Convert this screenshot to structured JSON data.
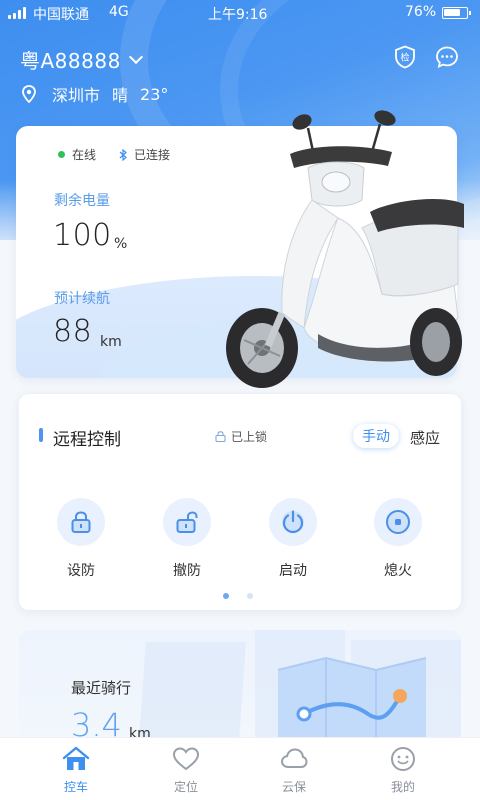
{
  "status_bar": {
    "carrier": "中国联通",
    "network": "4G",
    "time": "上午9:16",
    "battery": "76%"
  },
  "header": {
    "plate": "粤A88888",
    "city": "深圳市",
    "weather": "晴",
    "temperature": "23°",
    "inspect_badge": "检"
  },
  "vehicle": {
    "online": "在线",
    "bluetooth": "已连接",
    "battery_label": "剩余电量",
    "battery_value": "100",
    "battery_unit": "%",
    "range_label": "预计续航",
    "range_value": "88",
    "range_unit": "km"
  },
  "remote": {
    "title": "远程控制",
    "lock_state": "已上锁",
    "mode_manual": "手动",
    "mode_sense": "感应",
    "buttons": [
      {
        "label": "设防",
        "icon": "lock-icon"
      },
      {
        "label": "撤防",
        "icon": "unlock-icon"
      },
      {
        "label": "启动",
        "icon": "power-icon"
      },
      {
        "label": "熄火",
        "icon": "stop-icon"
      }
    ],
    "page_count": 2,
    "active_page": 1
  },
  "ride": {
    "label": "最近骑行",
    "value": "3.4",
    "unit": "km"
  },
  "tabs": [
    {
      "label": "控车",
      "icon": "home-icon",
      "active": true
    },
    {
      "label": "定位",
      "icon": "heart-icon",
      "active": false
    },
    {
      "label": "云保",
      "icon": "cloud-icon",
      "active": false
    },
    {
      "label": "我的",
      "icon": "smile-icon",
      "active": false
    }
  ],
  "colors": {
    "accent": "#3d8ff2",
    "online": "#2ec05b",
    "metric_label": "#5a9ce8"
  }
}
